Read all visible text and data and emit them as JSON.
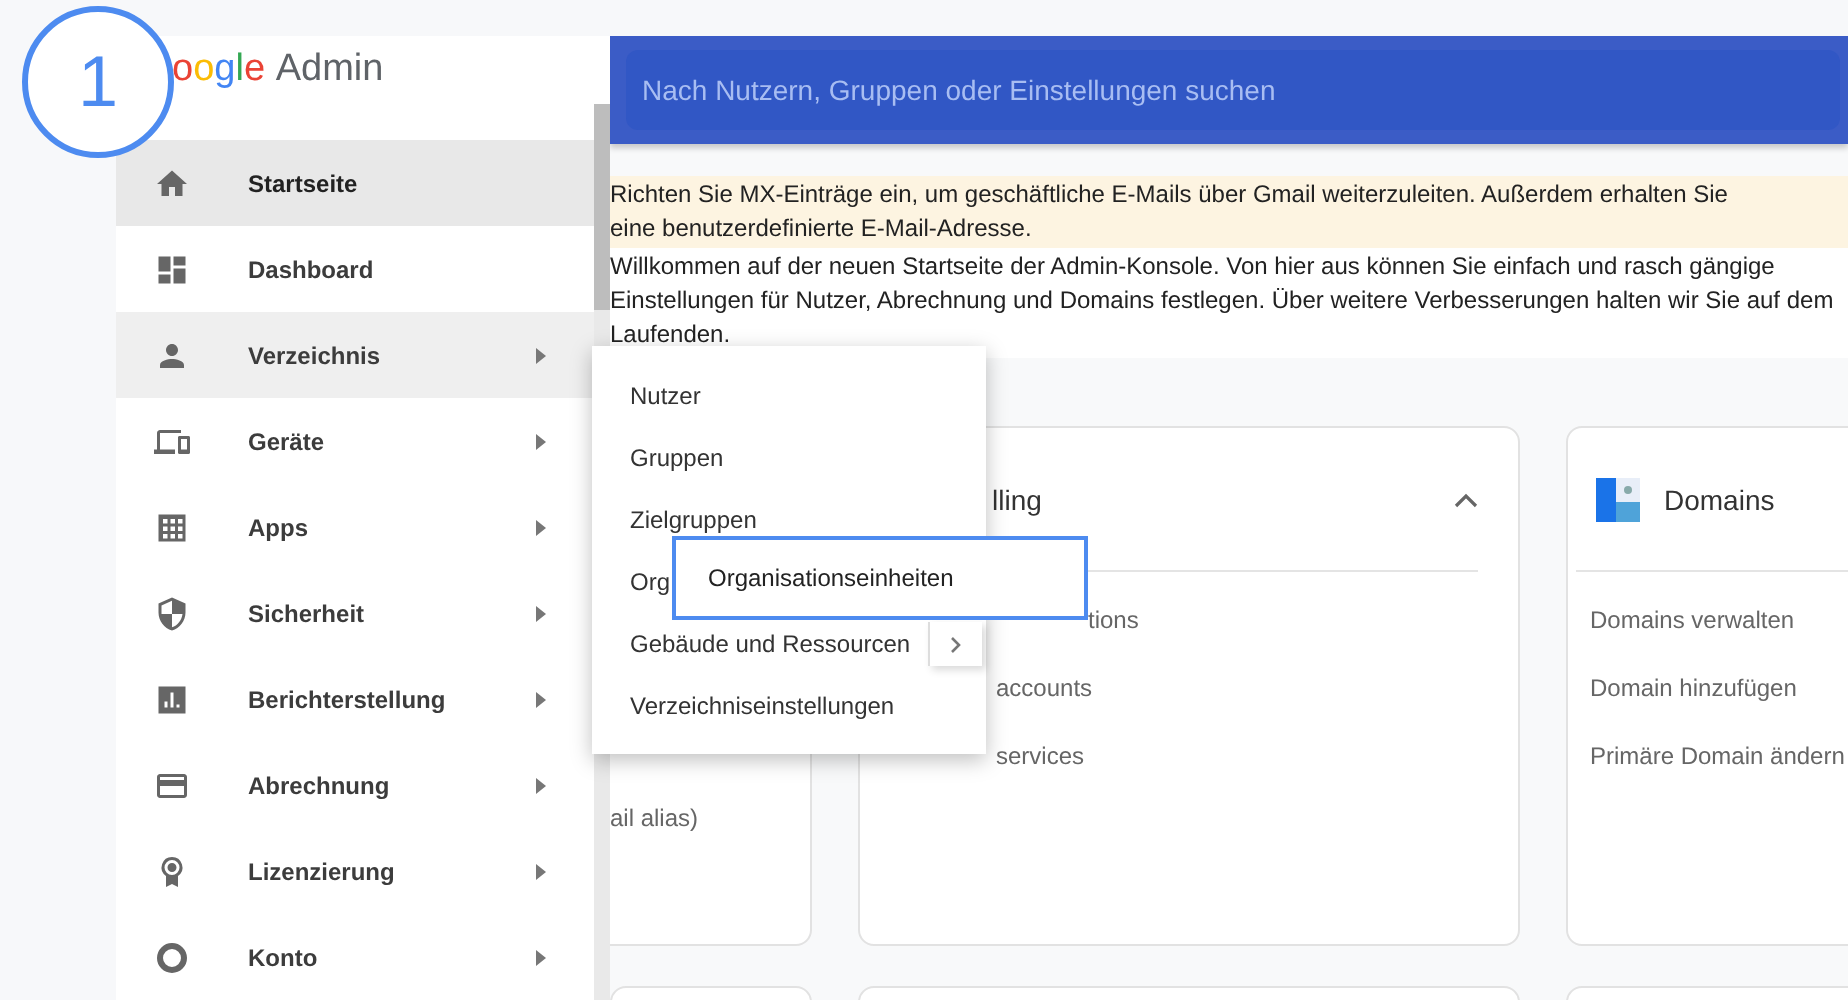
{
  "callout": {
    "number": "1"
  },
  "logo": {
    "brand": "oogle",
    "product": "Admin"
  },
  "search": {
    "placeholder": "Nach Nutzern, Gruppen oder Einstellungen suchen"
  },
  "sidebar": {
    "items": [
      {
        "label": "Startseite",
        "selected": true,
        "expanded": false,
        "has_submenu": false
      },
      {
        "label": "Dashboard",
        "selected": false,
        "expanded": false,
        "has_submenu": false
      },
      {
        "label": "Verzeichnis",
        "selected": false,
        "expanded": true,
        "has_submenu": true
      },
      {
        "label": "Geräte",
        "selected": false,
        "expanded": false,
        "has_submenu": true
      },
      {
        "label": "Apps",
        "selected": false,
        "expanded": false,
        "has_submenu": true
      },
      {
        "label": "Sicherheit",
        "selected": false,
        "expanded": false,
        "has_submenu": true
      },
      {
        "label": "Berichterstellung",
        "selected": false,
        "expanded": false,
        "has_submenu": true
      },
      {
        "label": "Abrechnung",
        "selected": false,
        "expanded": false,
        "has_submenu": true
      },
      {
        "label": "Lizenzierung",
        "selected": false,
        "expanded": false,
        "has_submenu": true
      },
      {
        "label": "Konto",
        "selected": false,
        "expanded": false,
        "has_submenu": true
      }
    ]
  },
  "notice": {
    "text": "Richten Sie MX-Einträge ein, um geschäftliche E-Mails über Gmail weiterzuleiten. Außerdem erhalten Sie eine benutzerdefinierte E-Mail-Adresse."
  },
  "welcome": {
    "text": "Willkommen auf der neuen Startseite der Admin-Konsole. Von hier aus können Sie einfach und rasch gängige Einstellungen für Nutzer, Abrechnung und Domains festlegen. Über weitere Verbesserungen halten wir Sie auf dem Laufenden."
  },
  "cards": [
    {
      "kind": "text",
      "lines": [
        "ail alias)"
      ]
    },
    {
      "kind": "collapsible",
      "title": "lling",
      "expanded": true,
      "links": [
        "tions",
        "accounts",
        "services"
      ]
    },
    {
      "kind": "icon",
      "title": "Domains",
      "links": [
        "Domains verwalten",
        "Domain hinzufügen",
        "Primäre Domain ändern"
      ]
    }
  ],
  "directory_menu": {
    "items": [
      {
        "label": "Nutzer",
        "has_submenu": false
      },
      {
        "label": "Gruppen",
        "has_submenu": false
      },
      {
        "label": "Zielgruppen",
        "has_submenu": false
      },
      {
        "label": "Org",
        "has_submenu": false
      },
      {
        "label": "Gebäude und Ressourcen",
        "has_submenu": true
      },
      {
        "label": "Verzeichniseinstellungen",
        "has_submenu": false
      }
    ]
  },
  "highlight": {
    "label": "Organisationseinheiten"
  }
}
